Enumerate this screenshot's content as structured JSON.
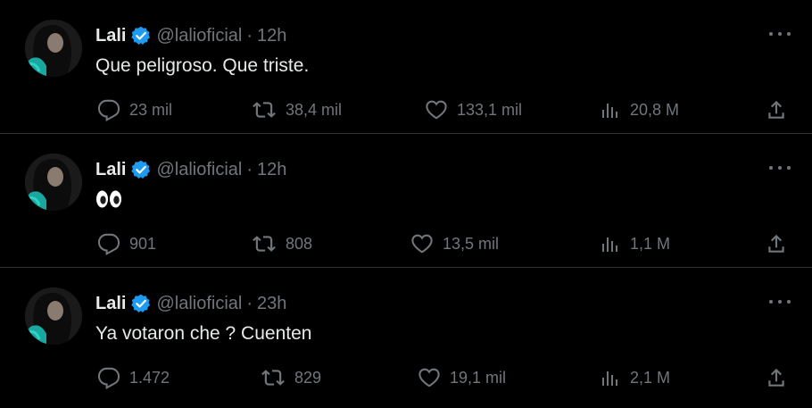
{
  "colors": {
    "background": "#000000",
    "text": "#e7e9ea",
    "muted": "#71767b",
    "divider": "#2f3336",
    "verified": "#1d9bf0"
  },
  "icons": {
    "verified": "verified-badge-icon",
    "more": "more-icon",
    "reply": "reply-icon",
    "repost": "repost-icon",
    "like": "like-icon",
    "views": "views-icon",
    "share": "share-icon"
  },
  "tweets": [
    {
      "name": "Lali",
      "handle": "@lalioficial",
      "separator": "·",
      "time": "12h",
      "text": "Que peligroso. Que triste.",
      "replies": "23 mil",
      "reposts": "38,4 mil",
      "likes": "133,1 mil",
      "views": "20,8 M"
    },
    {
      "name": "Lali",
      "handle": "@lalioficial",
      "separator": "·",
      "time": "12h",
      "text": "👀",
      "replies": "901",
      "reposts": "808",
      "likes": "13,5 mil",
      "views": "1,1 M"
    },
    {
      "name": "Lali",
      "handle": "@lalioficial",
      "separator": "·",
      "time": "23h",
      "text": "Ya votaron che ? Cuenten",
      "replies": "1.472",
      "reposts": "829",
      "likes": "19,1 mil",
      "views": "2,1 M"
    }
  ]
}
